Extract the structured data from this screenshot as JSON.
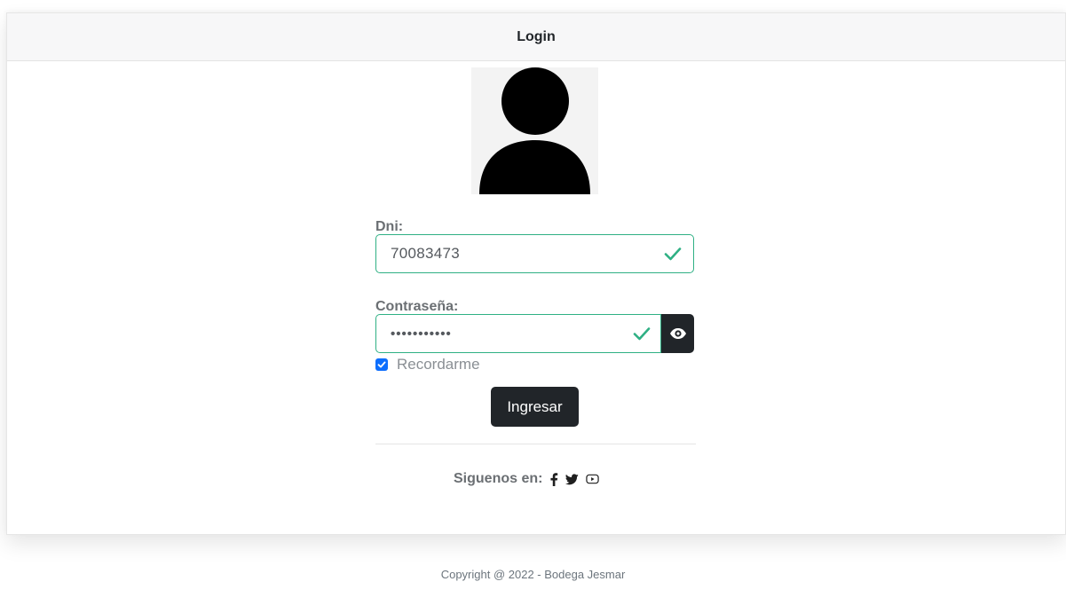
{
  "header": {
    "title": "Login"
  },
  "form": {
    "dni": {
      "label": "Dni:",
      "value": "70083473"
    },
    "password": {
      "label": "Contraseña:",
      "value_masked": "•••••••••••"
    },
    "remember": {
      "label": "Recordarme",
      "checked": true
    },
    "submit_label": "Ingresar"
  },
  "social": {
    "label": "Siguenos en:",
    "icons": [
      "facebook-icon",
      "twitter-icon",
      "youtube-icon"
    ]
  },
  "footer": {
    "text": "Copyright @ 2022 - Bodega Jesmar"
  },
  "colors": {
    "valid": "#2fb084",
    "dark_button": "#212529",
    "checkbox": "#0d6efd"
  }
}
